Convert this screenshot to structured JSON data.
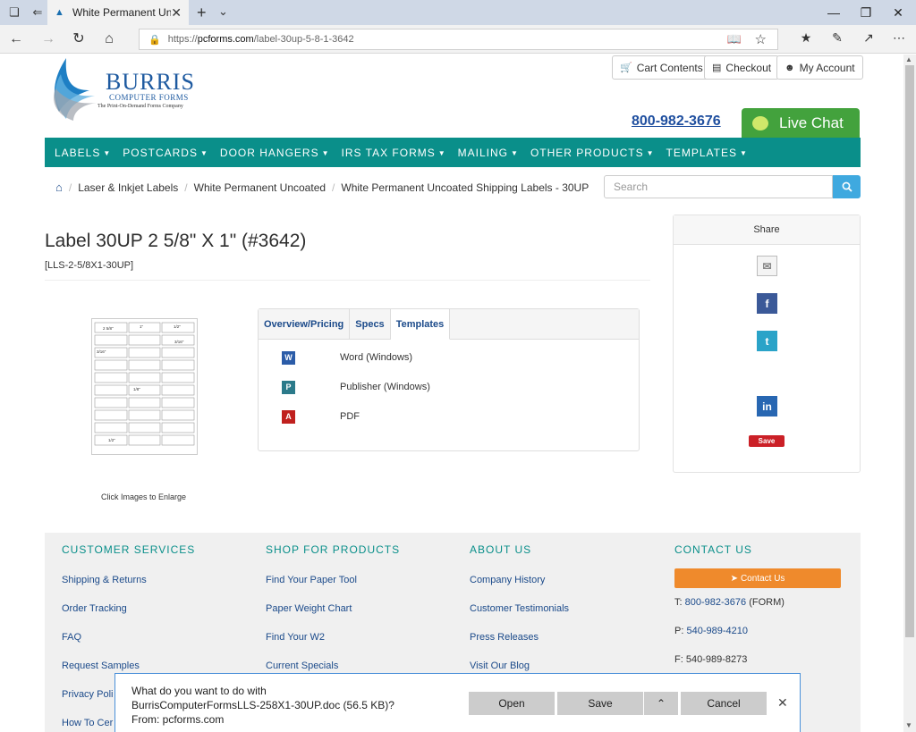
{
  "browser": {
    "tab_title": "White Permanent Uncoa",
    "url_prefix": "https://",
    "url_host": "pcforms.com",
    "url_path": "/label-30up-5-8-1-3642"
  },
  "header": {
    "brand": "BURRIS",
    "brand_sub": "COMPUTER FORMS",
    "tagline": "The Print-On-Demand Forms Company",
    "cart_label": "Cart Contents",
    "checkout_label": "Checkout",
    "account_label": "My Account",
    "phone": "800-982-3676",
    "live_chat": "Live Chat"
  },
  "nav": [
    "LABELS",
    "POSTCARDS",
    "DOOR HANGERS",
    "IRS TAX FORMS",
    "MAILING",
    "OTHER PRODUCTS",
    "TEMPLATES"
  ],
  "breadcrumb": [
    "Laser & Inkjet Labels",
    "White Permanent Uncoated",
    "White Permanent Uncoated Shipping Labels - 30UP"
  ],
  "search": {
    "placeholder": "Search"
  },
  "product": {
    "title": "Label 30UP 2 5/8\" X 1\" (#3642)",
    "sku": "[LLS-2-5/8X1-30UP]",
    "enlarge_hint": "Click Images to Enlarge",
    "diagram_labels": [
      "2 5/8\"",
      "1\"",
      "1/2\"",
      "3/16\"",
      "3/16\"",
      "1/8\"",
      "1/2\""
    ]
  },
  "tabs": {
    "items": [
      "Overview/Pricing",
      "Specs",
      "Templates"
    ],
    "downloads": [
      {
        "icon": "W",
        "label": "Word (Windows)",
        "color": "#2b5ca8"
      },
      {
        "icon": "P",
        "label": "Publisher (Windows)",
        "color": "#2b7a8a"
      },
      {
        "icon": "A",
        "label": "PDF",
        "color": "#c0201e"
      }
    ]
  },
  "share": {
    "title": "Share",
    "pin_label": "Save"
  },
  "footer": {
    "customer_services": {
      "heading": "CUSTOMER SERVICES",
      "links": [
        "Shipping & Returns",
        "Order Tracking",
        "FAQ",
        "Request Samples",
        "Privacy Poli",
        "How To Cer"
      ]
    },
    "shop": {
      "heading": "SHOP FOR PRODUCTS",
      "links": [
        "Find Your Paper Tool",
        "Paper Weight Chart",
        "Find Your W2",
        "Current Specials"
      ]
    },
    "about": {
      "heading": "ABOUT US",
      "links": [
        "Company History",
        "Customer Testimonials",
        "Press Releases",
        "Visit Our Blog"
      ]
    },
    "contact": {
      "heading": "CONTACT US",
      "button": "Contact Us",
      "t_prefix": "T:",
      "t_number": "800-982-3676",
      "t_suffix": "(FORM)",
      "p_prefix": "P:",
      "p_number": "540-989-4210",
      "f_line": "F: 540-989-8273"
    }
  },
  "download_bar": {
    "line1": "What do you want to do with",
    "line2": "BurrisComputerFormsLLS-258X1-30UP.doc (56.5 KB)?",
    "line3": "From: pcforms.com",
    "open": "Open",
    "save": "Save",
    "cancel": "Cancel"
  }
}
